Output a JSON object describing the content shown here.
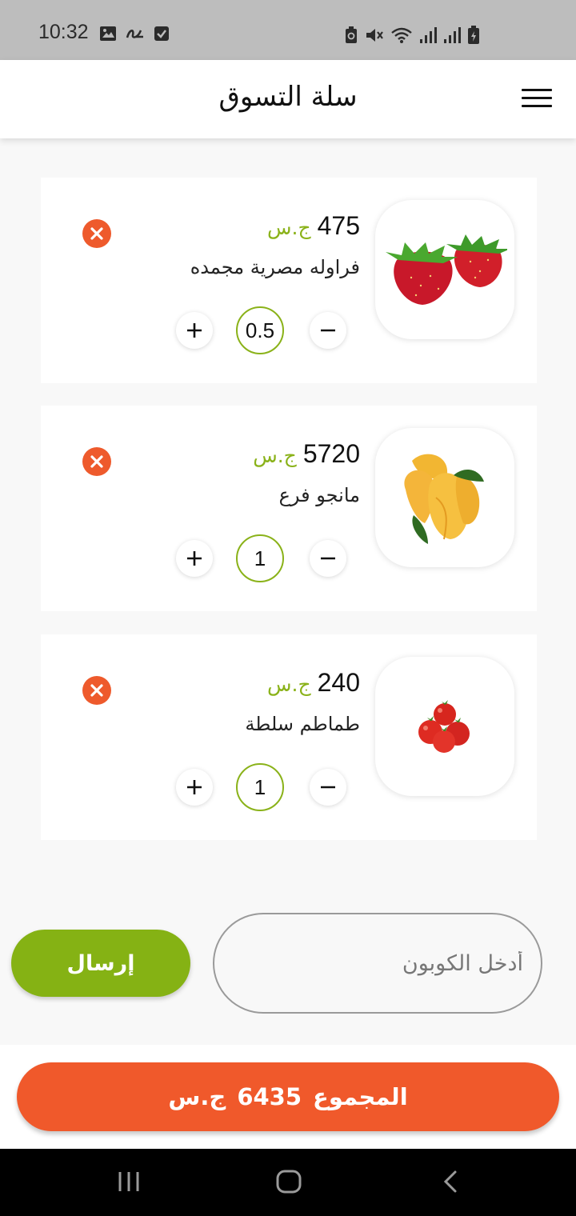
{
  "status_bar": {
    "time": "10:32",
    "left_icons": [
      "gallery-icon",
      "link-icon",
      "checkbox-icon"
    ],
    "right_icons": [
      "battery-saver-icon",
      "mute-icon",
      "wifi-icon",
      "signal-icon",
      "signal-icon",
      "battery-icon"
    ]
  },
  "header": {
    "title": "سلة التسوق",
    "menu_icon": "hamburger-menu-icon"
  },
  "cart": {
    "items": [
      {
        "name": "فراوله مصرية مجمده",
        "price": "475",
        "currency": "ج.س",
        "quantity": "0.5",
        "image": "strawberry"
      },
      {
        "name": "مانجو فرع",
        "price": "5720",
        "currency": "ج.س",
        "quantity": "1",
        "image": "mango"
      },
      {
        "name": "طماطم سلطة",
        "price": "240",
        "currency": "ج.س",
        "quantity": "1",
        "image": "tomato"
      }
    ]
  },
  "coupon": {
    "placeholder": "أدخل الكوبون",
    "value": "",
    "submit_label": "إرسال"
  },
  "total": {
    "label": "المجموع",
    "amount": "6435",
    "currency": "ج.س"
  },
  "colors": {
    "accent_green": "#8ab219",
    "accent_orange": "#f0592b",
    "remove_red": "#ee5a2c"
  },
  "nav_bar": {
    "buttons": [
      "recent-apps-icon",
      "home-icon",
      "back-icon"
    ]
  }
}
